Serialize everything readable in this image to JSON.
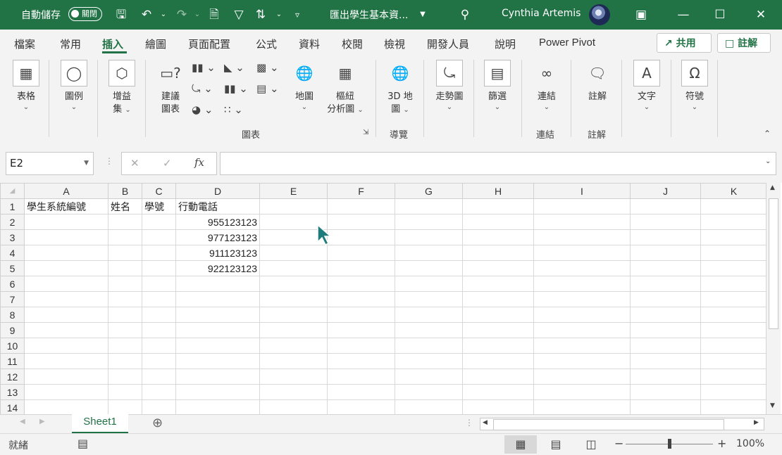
{
  "titlebar": {
    "autosave_label": "自動儲存",
    "autosave_state": "關閉",
    "doc_title": "匯出學生基本資...",
    "user_name": "Cynthia Artemis",
    "bg_color": "#217346"
  },
  "tabs": [
    "檔案",
    "常用",
    "插入",
    "繪圖",
    "頁面配置",
    "公式",
    "資料",
    "校閱",
    "檢視",
    "開發人員",
    "說明",
    "Power Pivot"
  ],
  "share_label": "共用",
  "comments_label": "註解",
  "ribbon": {
    "table": "表格",
    "illustrations": "圖例",
    "addins_1": "增益",
    "addins_2": "集",
    "recommended_1": "建議",
    "recommended_2": "圖表",
    "maps": "地圖",
    "pivotchart_1": "樞紐",
    "pivotchart_2": "分析圖",
    "charts_group": "圖表",
    "map3d_1": "3D 地",
    "map3d_2": "圖",
    "tours_group": "導覽",
    "sparklines": "走勢圖",
    "filters": "篩選",
    "link": "連結",
    "links_group": "連結",
    "comment": "註解",
    "comments_group": "註解",
    "text": "文字",
    "symbols": "符號"
  },
  "formula": {
    "namebox": "E2",
    "value": ""
  },
  "sheet": {
    "columns": [
      "A",
      "B",
      "C",
      "D",
      "E",
      "F",
      "G",
      "H",
      "I",
      "J",
      "K"
    ],
    "rows": [
      [
        "學生系統編號",
        "姓名",
        "學號",
        "行動電話",
        "",
        "",
        "",
        "",
        "",
        "",
        ""
      ],
      [
        "",
        "",
        "",
        "955123123",
        "",
        "",
        "",
        "",
        "",
        "",
        ""
      ],
      [
        "",
        "",
        "",
        "977123123",
        "",
        "",
        "",
        "",
        "",
        "",
        ""
      ],
      [
        "",
        "",
        "",
        "911123123",
        "",
        "",
        "",
        "",
        "",
        "",
        ""
      ],
      [
        "",
        "",
        "",
        "922123123",
        "",
        "",
        "",
        "",
        "",
        "",
        ""
      ],
      [
        "",
        "",
        "",
        "",
        "",
        "",
        "",
        "",
        "",
        "",
        ""
      ],
      [
        "",
        "",
        "",
        "",
        "",
        "",
        "",
        "",
        "",
        "",
        ""
      ],
      [
        "",
        "",
        "",
        "",
        "",
        "",
        "",
        "",
        "",
        "",
        ""
      ],
      [
        "",
        "",
        "",
        "",
        "",
        "",
        "",
        "",
        "",
        "",
        ""
      ],
      [
        "",
        "",
        "",
        "",
        "",
        "",
        "",
        "",
        "",
        "",
        ""
      ],
      [
        "",
        "",
        "",
        "",
        "",
        "",
        "",
        "",
        "",
        "",
        ""
      ],
      [
        "",
        "",
        "",
        "",
        "",
        "",
        "",
        "",
        "",
        "",
        ""
      ],
      [
        "",
        "",
        "",
        "",
        "",
        "",
        "",
        "",
        "",
        "",
        ""
      ],
      [
        "",
        "",
        "",
        "",
        "",
        "",
        "",
        "",
        "",
        "",
        ""
      ]
    ]
  },
  "sheet_tab": "Sheet1",
  "status": {
    "ready": "就緒",
    "zoom": "100%"
  }
}
